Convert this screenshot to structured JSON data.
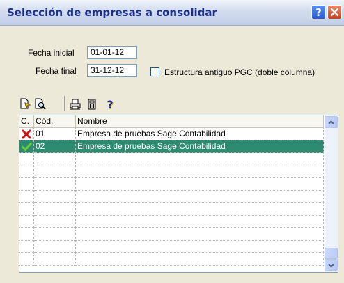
{
  "window": {
    "title": "Selección de empresas a consolidar",
    "help_label": "?"
  },
  "form": {
    "fecha_inicial_label": "Fecha inicial",
    "fecha_inicial_value": "01-01-12",
    "fecha_final_label": "Fecha final",
    "fecha_final_value": "31-12-12",
    "checkbox_label": "Estructura antiguo PGC (doble columna)",
    "checkbox_checked": false
  },
  "toolbar": {
    "icons": [
      "select-all-icon",
      "find-icon",
      "print-icon",
      "calculator-icon",
      "help-icon"
    ],
    "help_glyph": "?"
  },
  "table": {
    "columns": [
      "C.",
      "Cód.",
      "Nombre"
    ],
    "rows": [
      {
        "status": "excluded",
        "status_icon": "red-x-icon",
        "codigo": "01",
        "nombre": "Empresa de pruebas Sage Contabilidad",
        "selected": false
      },
      {
        "status": "included",
        "status_icon": "green-check-icon",
        "codigo": "02",
        "nombre": "Empresa de pruebas Sage Contabilidad",
        "selected": true
      }
    ],
    "selection_color": "#2E8B71"
  },
  "colors": {
    "window_bg": "#ECE9D8",
    "title_text": "#1A2E8A",
    "close_red": "#C8401A"
  }
}
